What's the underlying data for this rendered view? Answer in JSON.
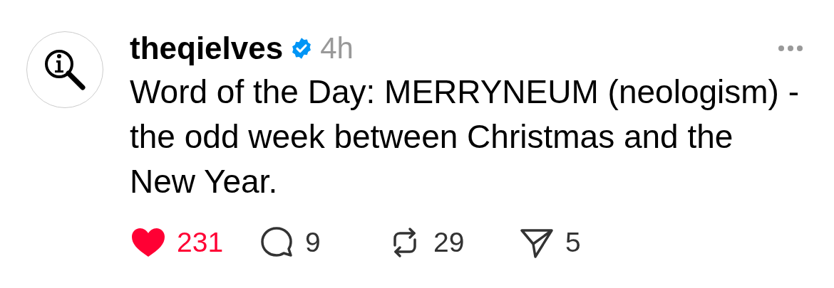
{
  "post": {
    "author": "theqielves",
    "verified": true,
    "time": "4h",
    "text": "Word of the Day: MERRYNEUM (neologism) - the odd week between Christmas and the New Year.",
    "actions": [
      {
        "kind": "like",
        "selected": true,
        "count": "231"
      },
      {
        "kind": "reply",
        "count": "9"
      },
      {
        "kind": "repost",
        "count": "29"
      },
      {
        "kind": "share",
        "count": "5"
      }
    ]
  }
}
